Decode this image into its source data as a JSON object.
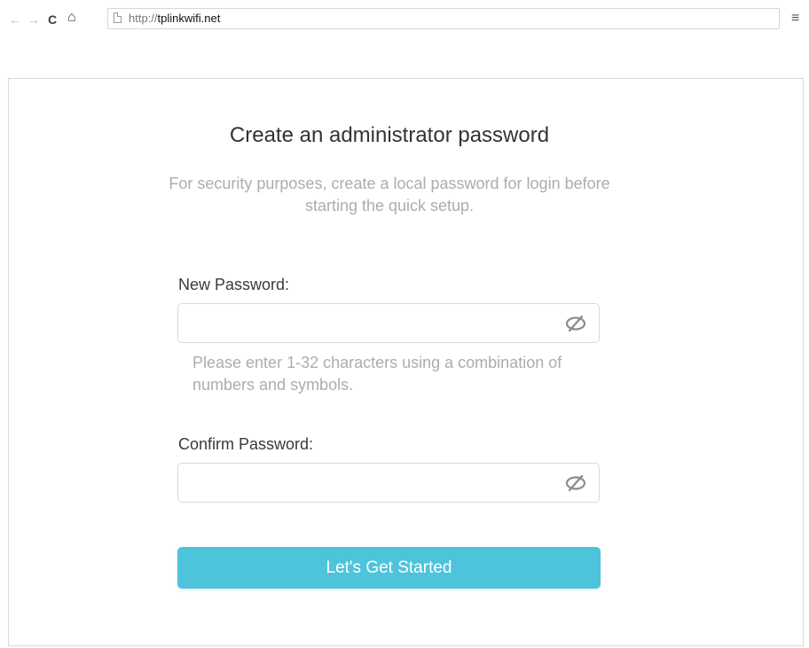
{
  "browser": {
    "back_glyph": "←",
    "forward_glyph": "→",
    "reload_glyph": "C",
    "home_glyph": "⌂",
    "url_protocol": "http://",
    "url_host": "tplinkwifi.net",
    "menu_glyph": "≡",
    "icons": [
      "back-arrow-icon",
      "forward-arrow-icon",
      "reload-icon",
      "home-icon",
      "page-icon",
      "menu-icon"
    ]
  },
  "form": {
    "title": "Create an administrator password",
    "subtitle": "For security purposes, create a local password for login before starting the quick setup.",
    "new_password": {
      "label": "New Password:",
      "value": "",
      "visibility_icon": "eye-slash-icon"
    },
    "hint": "Please enter 1-32 characters using a combination of numbers and symbols.",
    "confirm_password": {
      "label": "Confirm Password:",
      "value": "",
      "visibility_icon": "eye-slash-icon"
    },
    "submit_label": "Let's Get Started"
  },
  "colors": {
    "accent": "#4dc4dc",
    "muted_text": "#a9adb2",
    "label_text": "#3a3a3a",
    "border": "#d8dadd"
  }
}
